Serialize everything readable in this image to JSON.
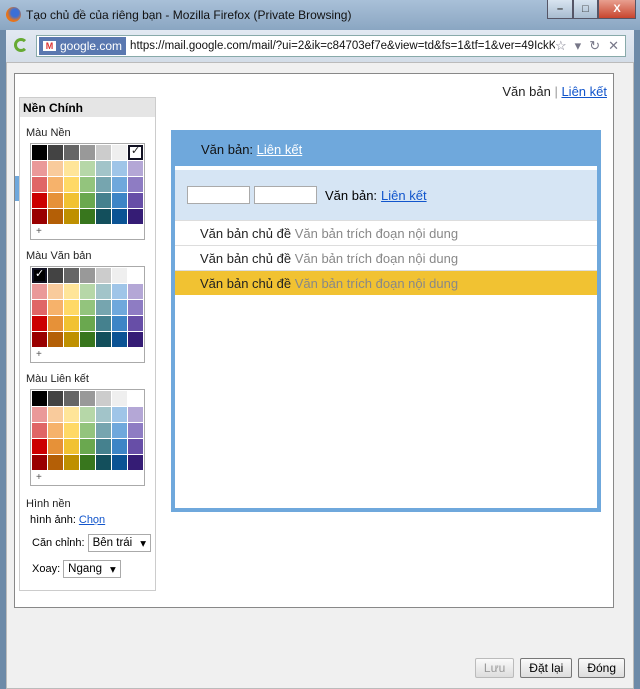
{
  "window": {
    "title": "Tạo chủ đề của riêng bạn - Mozilla Firefox (Private Browsing)",
    "minimize": "–",
    "maximize": "□",
    "close": "X"
  },
  "navbar": {
    "site": "google.com",
    "url": "https://mail.google.com/mail/?ui=2&ik=c84703ef7e&view=td&fs=1&tf=1&ver=49IckKMYteU.v",
    "star": "☆",
    "dropdown": "▾",
    "reload": "↻",
    "stop": "✕"
  },
  "top_links": {
    "text": "Văn bản",
    "sep": "|",
    "link": "Liên kết"
  },
  "sidebar": {
    "title": "Nền Chính",
    "bg_label": "Màu Nền",
    "text_label": "Màu Văn bản",
    "link_label": "Màu Liên kết",
    "plus": "+",
    "image_title": "Hình nền",
    "image_label": "hình ảnh:",
    "image_link": "Chọn",
    "align_label": "Căn chỉnh:",
    "align_value": "Bên trái",
    "rotate_label": "Xoay:",
    "rotate_value": "Ngang",
    "palette": [
      "#000000",
      "#434343",
      "#666666",
      "#999999",
      "#cccccc",
      "#efefef",
      "#ffffff",
      "#ea9999",
      "#f9cb9c",
      "#ffe599",
      "#b6d7a8",
      "#a2c4c9",
      "#9fc5e8",
      "#b4a7d6",
      "#e06666",
      "#f6b26b",
      "#ffd966",
      "#93c47d",
      "#76a5af",
      "#6fa8dc",
      "#8e7cc3",
      "#cc0000",
      "#e69138",
      "#f1c232",
      "#6aa84f",
      "#45818e",
      "#3d85c6",
      "#674ea7",
      "#990000",
      "#b45f06",
      "#bf9000",
      "#38761d",
      "#134f5c",
      "#0b5394",
      "#351c75"
    ],
    "selected": {
      "bg": 6,
      "text": 0,
      "link": -1
    }
  },
  "preview": {
    "header_text": "Văn bản:",
    "header_link": "Liên kết",
    "bar_text": "Văn bản:",
    "bar_link": "Liên kết",
    "rows": [
      {
        "subject": "Văn bản chủ đề",
        "snippet": "Văn bản trích đoạn nội dung",
        "highlighted": false
      },
      {
        "subject": "Văn bản chủ đề",
        "snippet": "Văn bản trích đoạn nội dung",
        "highlighted": false
      },
      {
        "subject": "Văn bản chủ đề",
        "snippet": "Văn bản trích đoạn nội dung",
        "highlighted": true
      }
    ]
  },
  "buttons": {
    "save": "Lưu",
    "reset": "Đặt lại",
    "close": "Đóng"
  }
}
